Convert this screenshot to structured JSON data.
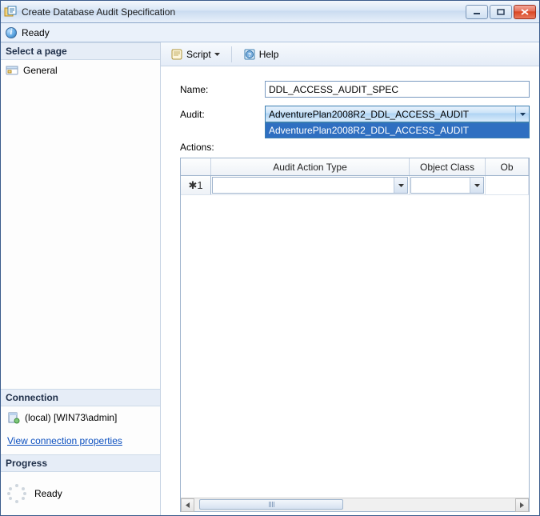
{
  "window": {
    "title": "Create Database Audit Specification"
  },
  "status": {
    "text": "Ready"
  },
  "left": {
    "select_page_hdr": "Select a page",
    "pages": [
      {
        "label": "General"
      }
    ],
    "connection_hdr": "Connection",
    "connection_text": "(local) [WIN73\\admin]",
    "connection_link": "View connection properties",
    "progress_hdr": "Progress",
    "progress_text": "Ready"
  },
  "toolbar": {
    "script_label": "Script",
    "help_label": "Help"
  },
  "form": {
    "name_label": "Name:",
    "name_value": "DDL_ACCESS_AUDIT_SPEC",
    "audit_label": "Audit:",
    "audit_value": "AdventurePlan2008R2_DDL_ACCESS_AUDIT",
    "audit_options": [
      "AdventurePlan2008R2_DDL_ACCESS_AUDIT"
    ],
    "actions_label": "Actions:"
  },
  "grid": {
    "columns": [
      "",
      "Audit Action Type",
      "Object Class",
      "Ob"
    ],
    "new_row_marker": "✱1"
  }
}
